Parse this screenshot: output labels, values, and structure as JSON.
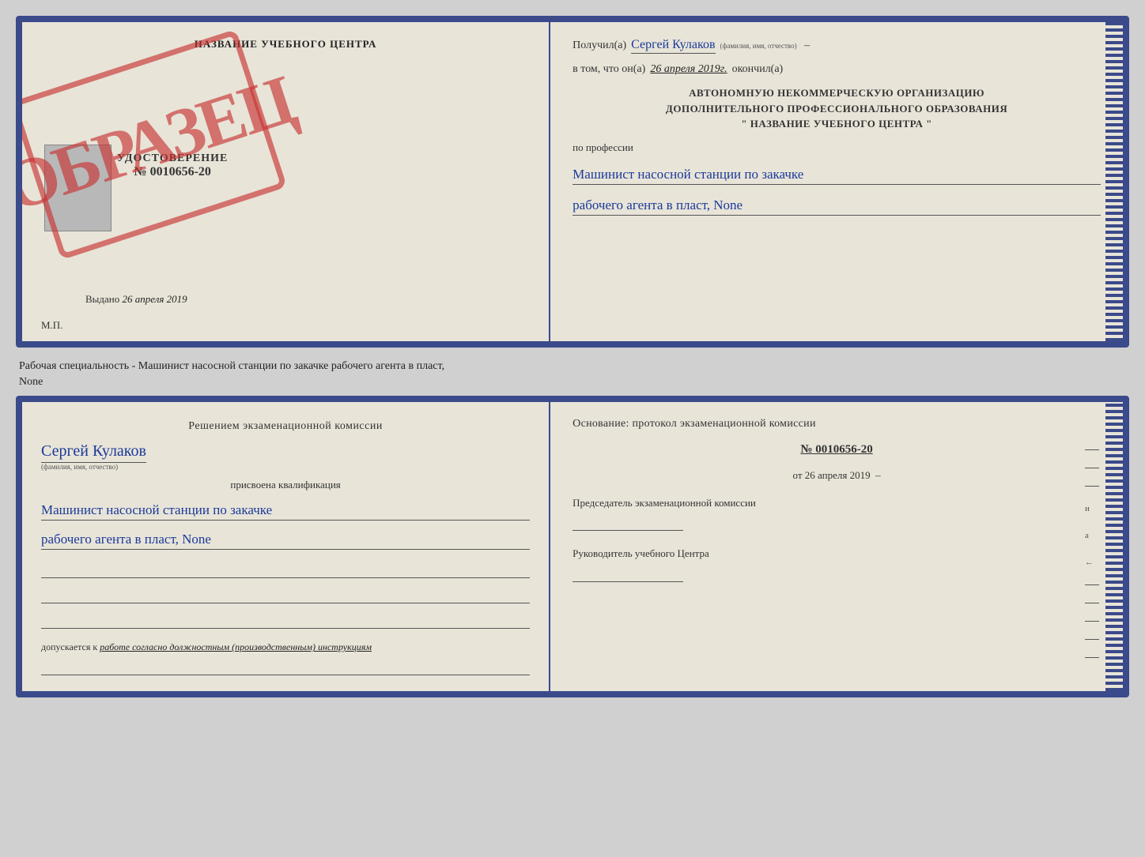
{
  "top_cert": {
    "left": {
      "title": "НАЗВАНИЕ УЧЕБНОГО ЦЕНТРА",
      "stamp_text": "ОБРАЗЕЦ",
      "udostoverenie_label": "УДОСТОВЕРЕНИЕ",
      "number": "№ 0010656-20",
      "vydano_label": "Выдано",
      "vydano_date": "26 апреля 2019",
      "mp_label": "М.П."
    },
    "right": {
      "poluchil_label": "Получил(а)",
      "recipient_name": "Сергей Кулаков",
      "familiya_hint": "(фамилия, имя, отчество)",
      "vtom_label": "в том, что он(а)",
      "date": "26 апреля 2019г.",
      "okonchil_label": "окончил(а)",
      "org_line1": "АВТОНОМНУЮ НЕКОММЕРЧЕСКУЮ ОРГАНИЗАЦИЮ",
      "org_line2": "ДОПОЛНИТЕЛЬНОГО ПРОФЕССИОНАЛЬНОГО ОБРАЗОВАНИЯ",
      "org_line3": "\"    НАЗВАНИЕ УЧЕБНОГО ЦЕНТРА    \"",
      "po_professii": "по профессии",
      "profession_line1": "Машинист насосной станции по закачке",
      "profession_line2": "рабочего агента в пласт, None"
    }
  },
  "specialty_text": "Рабочая специальность - Машинист насосной станции по закачке рабочего агента в пласт,",
  "specialty_text2": "None",
  "bottom_cert": {
    "left": {
      "komissia_text": "Решением экзаменационной комиссии",
      "name": "Сергей Кулаков",
      "familiya_hint": "(фамилия, имя, отчество)",
      "prisvoena": "присвоена квалификация",
      "qual_line1": "Машинист насосной станции по закачке",
      "qual_line2": "рабочего агента в пласт, None",
      "dopuskaetsya_label": "допускается к",
      "dopuskaetsya_value": "работе согласно должностным (производственным) инструкциям"
    },
    "right": {
      "osnovanie_label": "Основание: протокол экзаменационной комиссии",
      "protocol_number": "№ 0010656-20",
      "ot_label": "от",
      "ot_date": "26 апреля 2019",
      "predsedatel_label": "Председатель экзаменационной комиссии",
      "rukovoditel_label": "Руководитель учебного Центра"
    }
  }
}
